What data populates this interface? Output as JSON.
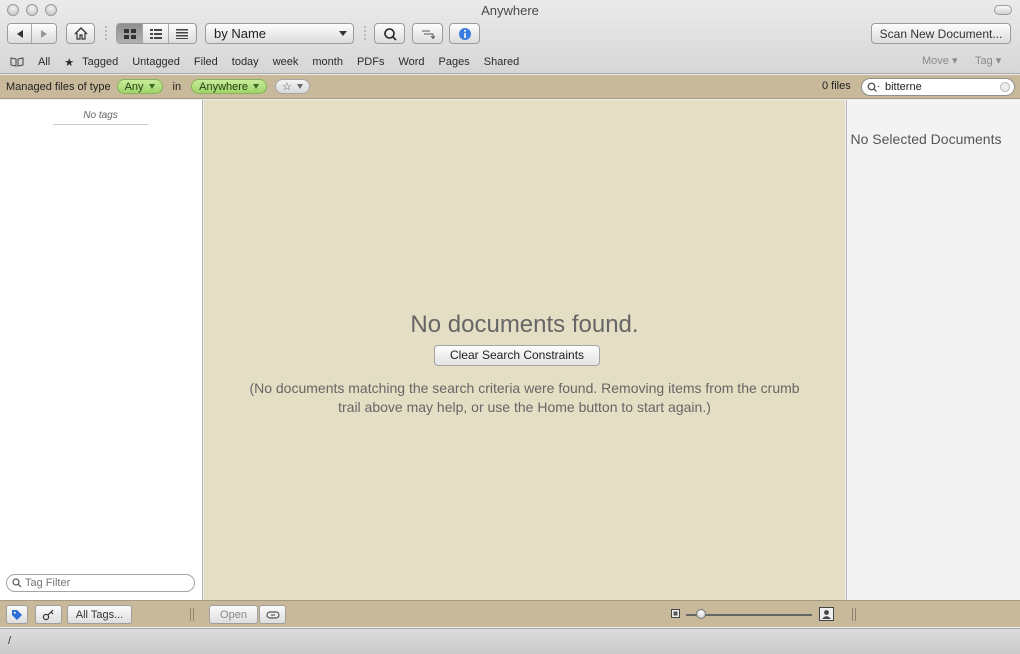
{
  "window": {
    "title": "Anywhere"
  },
  "toolbar": {
    "sort_value": "by Name",
    "scan_label": "Scan New Document..."
  },
  "filters": {
    "items": [
      "All",
      "Tagged",
      "Untagged",
      "Filed",
      "today",
      "week",
      "month",
      "PDFs",
      "Word",
      "Pages",
      "Shared"
    ],
    "move_label": "Move ▾",
    "tag_label": "Tag ▾"
  },
  "crumb": {
    "prefix": "Managed files of type",
    "type_value": "Any",
    "in_label": "in",
    "location_value": "Anywhere",
    "star_label": "☆",
    "file_count": "0 files",
    "search_value": "bitterne"
  },
  "left_pane": {
    "no_tags": "No tags",
    "tag_filter_placeholder": "Tag Filter"
  },
  "center_pane": {
    "empty_title": "No documents found.",
    "clear_button": "Clear Search Constraints",
    "empty_message": "(No documents matching the search criteria were found. Removing items from the crumb trail above may help, or use the Home button to start again.)"
  },
  "right_pane": {
    "no_selection": "No Selected Documents"
  },
  "bottom_bar": {
    "all_tags": "All Tags...",
    "open": "Open"
  },
  "status_bar": {
    "path": "/"
  },
  "colors": {
    "crumb_bg": "#c8b99a",
    "center_bg": "#e4dec4",
    "pill_green": "#9fd36a"
  }
}
